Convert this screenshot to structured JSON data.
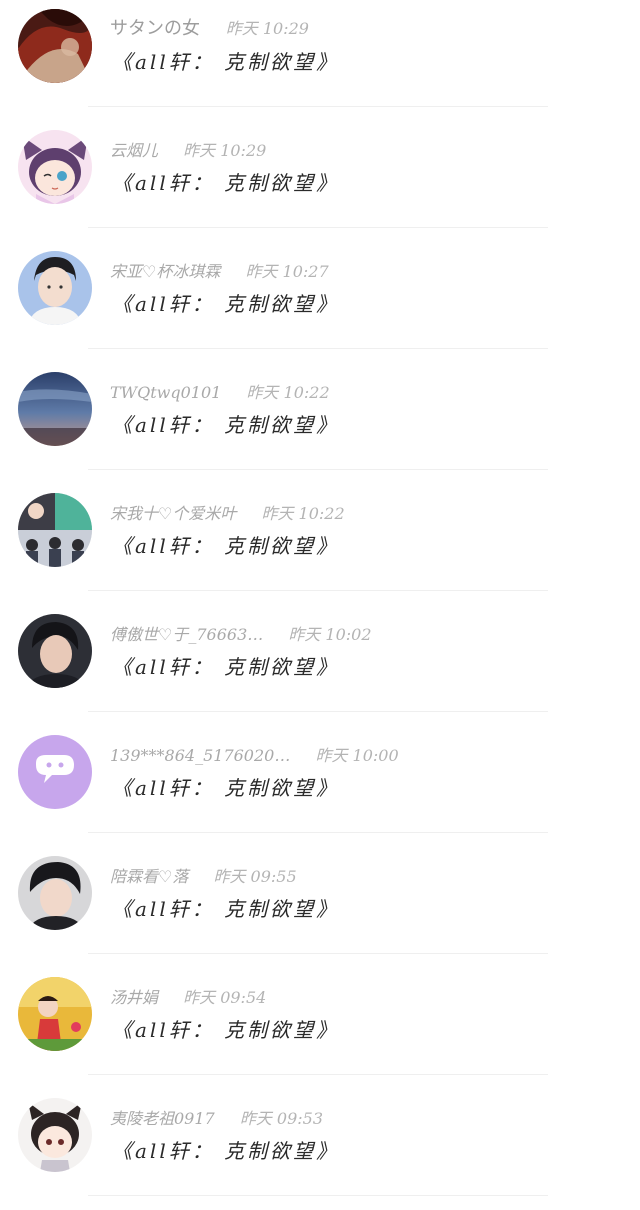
{
  "comments": [
    {
      "name": "サタンの女",
      "time": "昨天 10:29",
      "message": "《all轩： 克制欲望》",
      "avatar": "red-abstract"
    },
    {
      "name": "云烟儿",
      "time": "昨天 10:29",
      "message": "《all轩： 克制欲望》",
      "avatar": "anime-girl-cat-ears"
    },
    {
      "name": "宋亚♡杯冰琪霖",
      "time": "昨天 10:27",
      "message": "《all轩： 克制欲望》",
      "avatar": "young-man-portrait"
    },
    {
      "name": "TWQtwq0101",
      "time": "昨天 10:22",
      "message": "《all轩： 克制欲望》",
      "avatar": "blue-sky"
    },
    {
      "name": "宋我十♡个爱米叶",
      "time": "昨天 10:22",
      "message": "《all轩： 克制欲望》",
      "avatar": "group-collage"
    },
    {
      "name": "傅傲世♡于_76663…",
      "time": "昨天 10:02",
      "message": "《all轩： 克制欲望》",
      "avatar": "young-man-dark"
    },
    {
      "name": "139***864_5176020…",
      "time": "昨天 10:00",
      "message": "《all轩： 克制欲望》",
      "avatar": "default-chat-bubble"
    },
    {
      "name": "陪霖看♡落",
      "time": "昨天 09:55",
      "message": "《all轩： 克制欲望》",
      "avatar": "young-man-side"
    },
    {
      "name": "汤井娟",
      "time": "昨天 09:54",
      "message": "《all轩： 克制欲望》",
      "avatar": "child-photo"
    },
    {
      "name": "夷陵老祖0917",
      "time": "昨天 09:53",
      "message": "《all轩： 克制欲望》",
      "avatar": "anime-chibi"
    }
  ]
}
